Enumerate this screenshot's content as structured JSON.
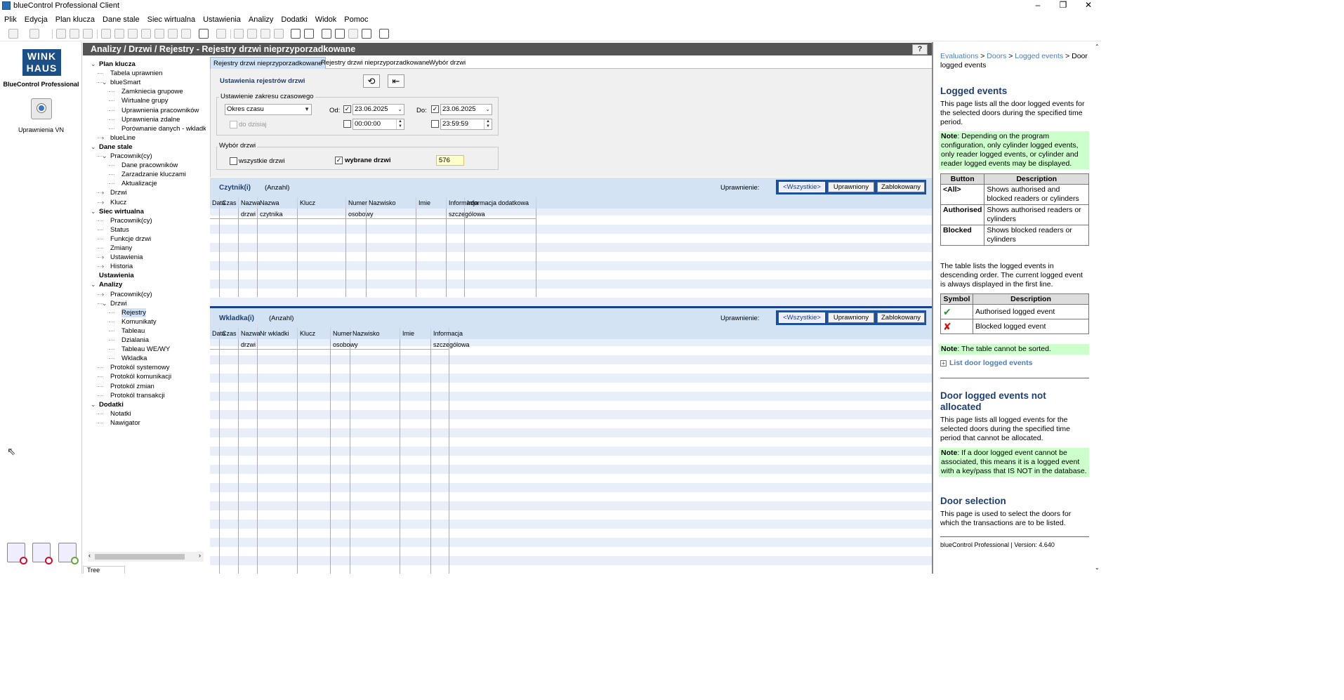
{
  "window": {
    "title": "blueControl Professional Client",
    "min": "–",
    "max": "❐",
    "close": "✕"
  },
  "menu": [
    "Plik",
    "Edycja",
    "Plan klucza",
    "Dane stale",
    "Siec wirtualna",
    "Ustawienia",
    "Analizy",
    "Dodatki",
    "Widok",
    "Pomoc"
  ],
  "sidebar": {
    "logo": "WINK\nHAUS",
    "logo_caption": "BlueControl Professional",
    "vn_label": "Uprawnienia VN"
  },
  "tree": {
    "tab": "Tree",
    "items": [
      {
        "label": "Plan klucza",
        "bold": true,
        "lvl": 0,
        "exp": "open"
      },
      {
        "label": "Tabela uprawnien",
        "lvl": 1
      },
      {
        "label": "blueSmart",
        "lvl": 1,
        "exp": "open"
      },
      {
        "label": "Zamkniecia grupowe",
        "lvl": 2
      },
      {
        "label": "Wirtualne grupy",
        "lvl": 2
      },
      {
        "label": "Uprawnienia pracowników",
        "lvl": 2
      },
      {
        "label": "Uprawnienia zdalne",
        "lvl": 2
      },
      {
        "label": "Porównanie danych - wkladki l",
        "lvl": 2
      },
      {
        "label": "blueLine",
        "lvl": 1,
        "exp": "closed"
      },
      {
        "label": "Dane stale",
        "bold": true,
        "lvl": 0,
        "exp": "open"
      },
      {
        "label": "Pracownik(cy)",
        "lvl": 1,
        "exp": "open"
      },
      {
        "label": "Dane pracowników",
        "lvl": 2
      },
      {
        "label": "Zarzadzanie kluczami",
        "lvl": 2
      },
      {
        "label": "Aktualizacje",
        "lvl": 2
      },
      {
        "label": "Drzwi",
        "lvl": 1,
        "exp": "closed"
      },
      {
        "label": "Klucz",
        "lvl": 1,
        "exp": "closed"
      },
      {
        "label": "Siec wirtualna",
        "bold": true,
        "lvl": 0,
        "exp": "open"
      },
      {
        "label": "Pracownik(cy)",
        "lvl": 1
      },
      {
        "label": "Status",
        "lvl": 1
      },
      {
        "label": "Funkcje drzwi",
        "lvl": 1
      },
      {
        "label": "Zmiany",
        "lvl": 1
      },
      {
        "label": "Ustawienia",
        "lvl": 1,
        "exp": "closed"
      },
      {
        "label": "Historia",
        "lvl": 1,
        "exp": "closed"
      },
      {
        "label": "Ustawienia",
        "bold": true,
        "lvl": 0
      },
      {
        "label": "Analizy",
        "bold": true,
        "lvl": 0,
        "exp": "open"
      },
      {
        "label": "Pracownik(cy)",
        "lvl": 1,
        "exp": "closed"
      },
      {
        "label": "Drzwi",
        "lvl": 1,
        "exp": "open"
      },
      {
        "label": "Rejestry",
        "lvl": 2,
        "sel": true
      },
      {
        "label": "Komunikaty",
        "lvl": 2
      },
      {
        "label": "Tableau",
        "lvl": 2
      },
      {
        "label": "Dzialania",
        "lvl": 2
      },
      {
        "label": "Tableau WE/WY",
        "lvl": 2
      },
      {
        "label": "Wkladka",
        "lvl": 2
      },
      {
        "label": "Protokól systemowy",
        "lvl": 1
      },
      {
        "label": "Protokól komunikacji",
        "lvl": 1
      },
      {
        "label": "Protokól zmian",
        "lvl": 1
      },
      {
        "label": "Protokól transakcji",
        "lvl": 1
      },
      {
        "label": "Dodatki",
        "bold": true,
        "lvl": 0,
        "exp": "open"
      },
      {
        "label": "Notatki",
        "lvl": 1
      },
      {
        "label": "Nawigator",
        "lvl": 1
      }
    ]
  },
  "header": {
    "title": "Analizy / Drzwi / Rejestry - Rejestry drzwi nieprzyporzadkowane",
    "help": "?"
  },
  "tabs": [
    "Rejestry drzwi nieprzyporzadkowane",
    "Rejestry drzwi nieprzyporzadkowane",
    "Wybór drzwi"
  ],
  "settings": {
    "title": "Ustawienia rejestrów drzwi",
    "time_group": "Ustawienie zakresu czasowego",
    "period": "Okres czasu",
    "to_today": "do dzisiaj",
    "from_label": "Od:",
    "from_date": "23.06.2025",
    "from_time": "00:00:00",
    "to_label": "Do:",
    "to_date": "23.06.2025",
    "to_time": "23:59:59",
    "door_group": "Wybór drzwi",
    "all_doors": "wszystkie drzwi",
    "selected_doors": "wybrane drzwi",
    "count": "576"
  },
  "readers": {
    "title": "Czytnik(i)",
    "sub": "(Anzahl)",
    "perm_label": "Uprawnienie:",
    "buttons": [
      "<Wszystkie>",
      "Uprawniony",
      "Zablokowany"
    ],
    "columns": [
      "Data",
      "Czas",
      "Nazwa drzwi",
      "Nazwa czytnika",
      "Klucz",
      "Numer osobowy",
      "Nazwisko",
      "Imie",
      "Informacja szczególowa",
      "Informacja dodatkowa"
    ]
  },
  "cylinders": {
    "title": "Wkladka(i)",
    "sub": "(Anzahl)",
    "perm_label": "Uprawnienie:",
    "buttons": [
      "<Wszystkie>",
      "Uprawniony",
      "Zablokowany"
    ],
    "columns": [
      "Data",
      "Czas",
      "Nazwa drzwi",
      "Nr wkladki",
      "Klucz",
      "Numer osobowy",
      "Nazwisko",
      "Imie",
      "Informacja szczególowa"
    ]
  },
  "help": {
    "breadcrumb": {
      "l1": "Evaluations",
      "l2": "Doors",
      "l3": "Logged events",
      "rest": "Door logged events",
      "sep": " > "
    },
    "h1": "Logged events",
    "p1": "This page lists all the door logged events for the selected doors during the specified time period.",
    "note_label": "Note",
    "n1": ": Depending on the program configuration, only cylinder logged events, only reader logged events, or cylinder and reader logged events may be displayed.",
    "t1_head": [
      "Button",
      "Description"
    ],
    "t1_rows": [
      [
        "<All>",
        "Shows authorised and blocked readers or cylinders"
      ],
      [
        "Authorised",
        "Shows authorised readers or cylinders"
      ],
      [
        "Blocked",
        "Shows blocked readers or cylinders"
      ]
    ],
    "p2": "The table lists the logged events in descending order. The current logged event is always displayed in the first line.",
    "t2_head": [
      "Symbol",
      "Description"
    ],
    "t2_rows": [
      [
        "✔",
        "Authorised logged event"
      ],
      [
        "✘",
        "Blocked logged event"
      ]
    ],
    "n2": ": The table cannot be sorted.",
    "link": "List door logged events",
    "h2": "Door logged events not allocated",
    "p3": "This page lists all logged events for the selected doors during the specified time period that cannot be allocated.",
    "n3": ": If a door logged event cannot be associated, this means it is a logged event with a key/pass that IS NOT in the database.",
    "h3": "Door selection",
    "p4": "This page is used to select the doors for which the transactions are to be listed.",
    "version": "blueControl Professional | Version: 4.640"
  },
  "colors": {
    "header_bg": "#555555",
    "accent": "#1c3f73",
    "grid_stripe": "#e8eff8",
    "note_bg": "#ccffcc"
  }
}
